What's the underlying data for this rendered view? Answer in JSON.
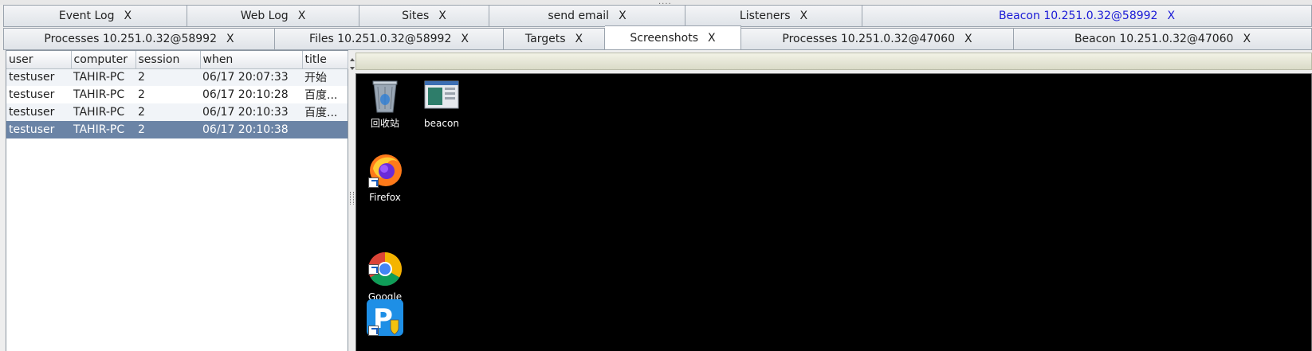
{
  "top_strip": {
    "grip": "...."
  },
  "tabs_row1": [
    {
      "label": "Event Log",
      "close": "X"
    },
    {
      "label": "Web Log",
      "close": "X"
    },
    {
      "label": "Sites",
      "close": "X"
    },
    {
      "label": "send email",
      "close": "X"
    },
    {
      "label": "Listeners",
      "close": "X"
    },
    {
      "label": "Beacon 10.251.0.32@58992",
      "close": "X",
      "highlight": true
    }
  ],
  "tabs_row2": [
    {
      "label": "Processes 10.251.0.32@58992",
      "close": "X"
    },
    {
      "label": "Files 10.251.0.32@58992",
      "close": "X"
    },
    {
      "label": "Targets",
      "close": "X"
    },
    {
      "label": "Screenshots",
      "close": "X",
      "active": true
    },
    {
      "label": "Processes 10.251.0.32@47060",
      "close": "X"
    },
    {
      "label": "Beacon 10.251.0.32@47060",
      "close": "X"
    }
  ],
  "table": {
    "columns": [
      "user",
      "computer",
      "session",
      "when",
      "title"
    ],
    "rows": [
      [
        "testuser",
        "TAHIR-PC",
        "2",
        "06/17 20:07:33",
        "开始"
      ],
      [
        "testuser",
        "TAHIR-PC",
        "2",
        "06/17 20:10:28",
        "百度..."
      ],
      [
        "testuser",
        "TAHIR-PC",
        "2",
        "06/17 20:10:33",
        "百度..."
      ],
      [
        "testuser",
        "TAHIR-PC",
        "2",
        "06/17 20:10:38",
        ""
      ]
    ],
    "selected_row": 3
  },
  "desktop": {
    "icons": [
      {
        "label": "回收站",
        "icon": "recycle-bin-icon"
      },
      {
        "label": "beacon",
        "icon": "executable-icon"
      },
      {
        "label": "Firefox",
        "icon": "firefox-icon"
      },
      {
        "label": "Google\nChrome",
        "icon": "chrome-icon"
      },
      {
        "label": "",
        "icon": "app-p-icon"
      }
    ]
  }
}
